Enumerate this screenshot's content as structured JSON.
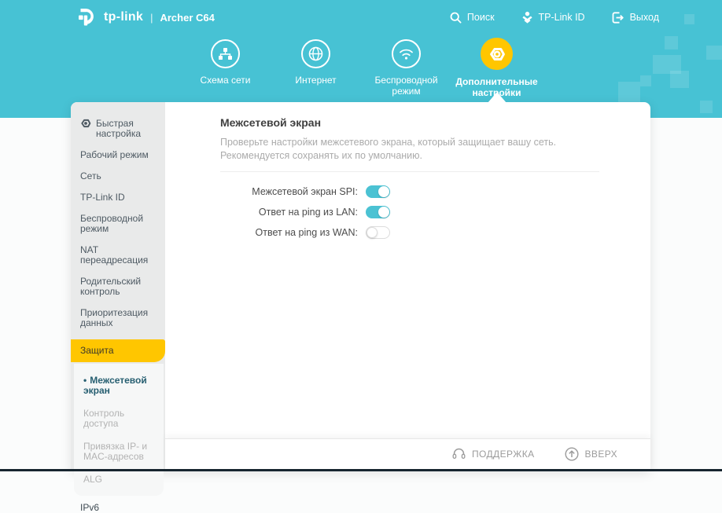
{
  "header": {
    "brand": "tp-link",
    "separator": "|",
    "model": "Archer C64",
    "search_label": "Поиск",
    "account_label": "TP-Link ID",
    "logout_label": "Выход"
  },
  "nav": {
    "items": [
      {
        "label": "Схема сети",
        "icon": "sitemap-icon",
        "active": false
      },
      {
        "label": "Интернет",
        "icon": "globe-icon",
        "active": false
      },
      {
        "label": "Беспроводной режим",
        "icon": "wifi-icon",
        "active": false
      },
      {
        "label": "Дополнительные настройки",
        "icon": "gear-icon",
        "active": true
      }
    ]
  },
  "sidebar": {
    "items": [
      {
        "label": "Быстрая настройка"
      },
      {
        "label": "Рабочий режим"
      },
      {
        "label": "Сеть"
      },
      {
        "label": "TP-Link ID"
      },
      {
        "label": "Беспроводной режим"
      },
      {
        "label": "NAT переадресация"
      },
      {
        "label": "Родительский контроль"
      },
      {
        "label": "Приоритезация данных"
      },
      {
        "label": "Защита",
        "active": true
      }
    ],
    "submenu": [
      {
        "label": "Межсетевой экран",
        "active": true
      },
      {
        "label": "Контроль доступа",
        "active": false
      },
      {
        "label": "Привязка IP- и MAC-адресов",
        "active": false
      },
      {
        "label": "ALG",
        "active": false
      }
    ],
    "ipv6_label": "IPv6",
    "bullet": "•"
  },
  "main": {
    "title": "Межсетевой экран",
    "description": "Проверьте настройки межсетевого экрана, который защищает вашу сеть. Рекомендуется сохранять их по умолчанию.",
    "settings": [
      {
        "label": "Межсетевой экран SPI:",
        "enabled": true
      },
      {
        "label": "Ответ на ping из LAN:",
        "enabled": true
      },
      {
        "label": "Ответ на ping из WAN:",
        "enabled": false
      }
    ]
  },
  "footer": {
    "support_label": "ПОДДЕРЖКА",
    "top_label": "ВВЕРХ"
  },
  "colors": {
    "teal": "#47c2d4",
    "teal_square": "#5bc9d8",
    "yellow": "#ffc600",
    "active_submenu_text": "#275f71",
    "toggle_on": "#4bc2d3",
    "bottom_strip": "#17252f"
  }
}
